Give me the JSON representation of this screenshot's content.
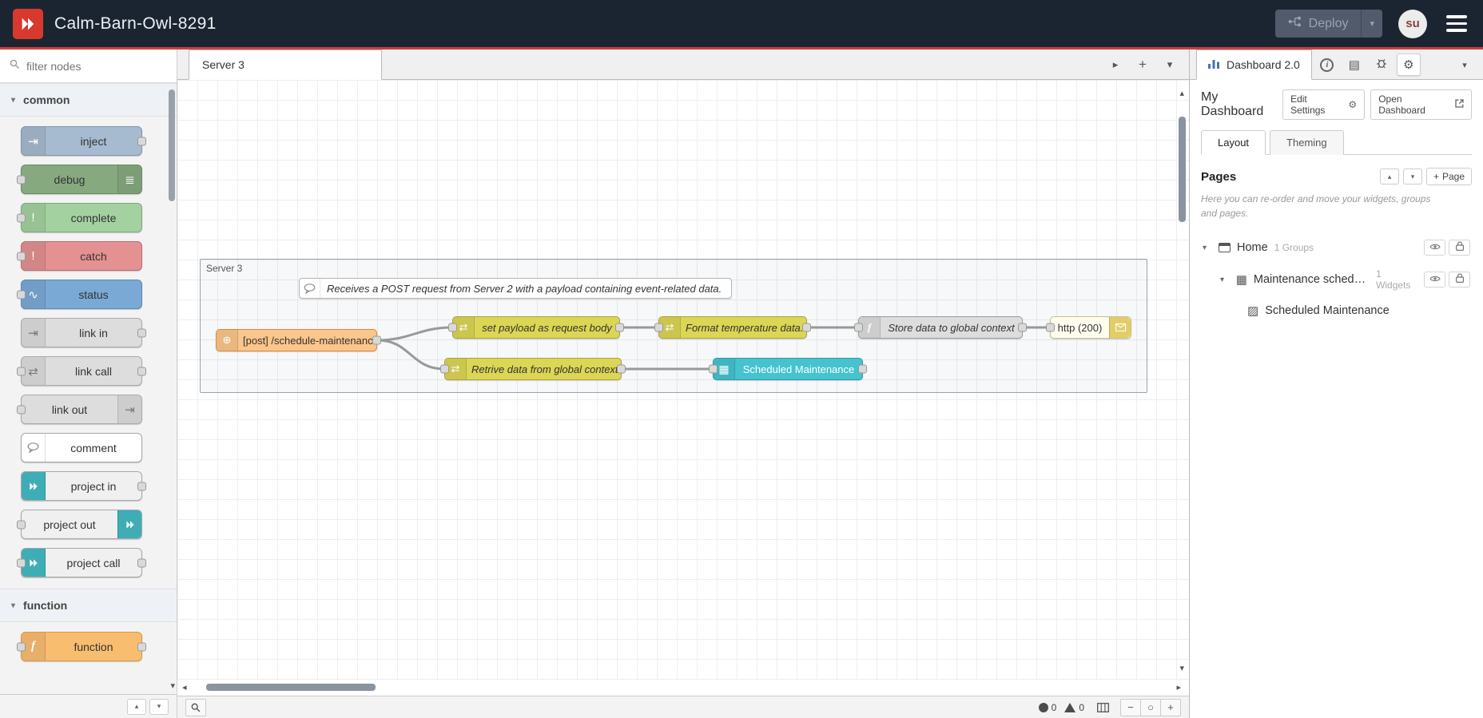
{
  "colors": {
    "header_bg": "#1b2532",
    "accent_red": "#d33c3c",
    "logo_red": "#d8392e",
    "deploy_bg": "#515b6b",
    "node_inject": "#a6bbcf",
    "node_debug": "#87a980",
    "node_complete": "#a3d1a0",
    "node_catch": "#e49191",
    "node_status": "#7aa9d6",
    "node_link": "#dddddd",
    "node_project": "#3fadb5",
    "node_function": "#f9bd6f",
    "node_http_in": "#fcc58b",
    "node_change": "#dcd655",
    "node_http_response": "#fffdf0",
    "node_table": "#45c3ce",
    "wire": "#999999"
  },
  "icons": {
    "chevron_down": "▾",
    "chevron_up": "▴",
    "chevron_right": "▸",
    "chevron_left": "◂",
    "plus": "+",
    "minus": "−",
    "zoom_reset": "○",
    "gear": "⚙",
    "docs": "▤",
    "table": "▦",
    "image": "▨",
    "inject": "⇥",
    "debug": "≣",
    "exclamation": "!",
    "status": "∿",
    "swap": "⇄",
    "function_f": "f",
    "globe": "⊕",
    "info_i": "i"
  },
  "header": {
    "title": "Calm-Barn-Owl-8291",
    "deploy_label": "Deploy",
    "user_initials": "su"
  },
  "palette": {
    "filter_placeholder": "filter nodes",
    "categories": [
      {
        "label": "common",
        "nodes": [
          "inject",
          "debug",
          "complete",
          "catch",
          "status",
          "link in",
          "link call",
          "link out",
          "comment",
          "project in",
          "project out",
          "project call"
        ]
      },
      {
        "label": "function",
        "nodes": [
          "function"
        ]
      }
    ]
  },
  "workspace": {
    "tab_label": "Server 3",
    "group_label": "Server 3",
    "comment_text": "Receives a POST request from Server 2 with a payload containing event-related data.",
    "nodes": {
      "http_in": "[post] /schedule-maintenance",
      "set_payload": "set payload as request body",
      "format_temp": "Format temperature data.",
      "store_global": "Store data to global context",
      "http_response": "http (200)",
      "retrieve_global": "Retrive data from global context",
      "table_widget": "Scheduled Maintenance"
    }
  },
  "sidebar": {
    "tab_label": "Dashboard 2.0",
    "dashboard_name": "My Dashboard",
    "edit_settings_label": "Edit Settings",
    "open_dashboard_label": "Open Dashboard",
    "layout_tab": "Layout",
    "theming_tab": "Theming",
    "pages_title": "Pages",
    "add_page_label": "Page",
    "help_text": "Here you can re-order and move your widgets, groups and pages.",
    "tree": {
      "page_label": "Home",
      "page_meta": "1 Groups",
      "group_label": "Maintenance schedul...",
      "group_meta": "1 Widgets",
      "widget_label": "Scheduled Maintenance"
    }
  },
  "statusbar": {
    "error_count": "0",
    "warning_count": "0"
  }
}
